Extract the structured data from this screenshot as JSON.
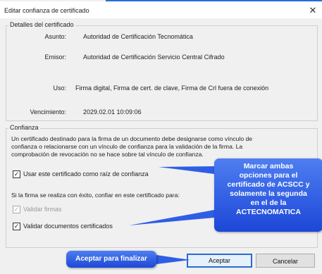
{
  "window": {
    "title": "Editar confianza de certificado",
    "close_glyph": "✕"
  },
  "details": {
    "legend": "Detalles del certificado",
    "subject_label": "Asunto:",
    "subject_value": "Autoridad de Certificación Tecnomática",
    "issuer_label": "Emisor:",
    "issuer_value": "Autoridad de Certificación Servicio Central Cifrado",
    "usage_label": "Uso:",
    "usage_value": "Firma digital, Firma de cert. de clave, Firma de Crl fuera de conexión",
    "expiry_label": "Vencimiento:",
    "expiry_value": "2029.02.01 10:09:06"
  },
  "trust": {
    "legend": "Confianza",
    "line1": "Un certificado destinado para la firma de un documento debe designarse como vínculo de",
    "line2": "confianza o relacionarse con un vínculo de confianza para la validación de la firma. La",
    "line3": "comprobación de revocación no se hace sobre tal vínculo de confianza.",
    "root_checkbox_label": "Usar este certificado como raíz de confianza",
    "root_checked": true,
    "sign_text": "Si la firma se realiza con éxito, confiar en este certificado para:",
    "validate_signatures_label": "Validar firmas",
    "validate_signatures_checked": true,
    "validate_signatures_disabled": true,
    "validate_docs_label": "Validar documentos certificados",
    "validate_docs_checked": true
  },
  "buttons": {
    "accept": "Aceptar",
    "cancel": "Cancelar"
  },
  "annotations": {
    "callout_lines": [
      "Marcar ambas",
      "opciones para el",
      "certificado de ACSCC y",
      "solamente la segunda",
      "en el de la",
      "ACTECNOMATICA"
    ],
    "accept_callout": "Aceptar para finalizar"
  },
  "colors": {
    "callout": "#2f5ee6",
    "primary_border": "#2a6ccf",
    "window_accent": "#2b6cd6"
  }
}
